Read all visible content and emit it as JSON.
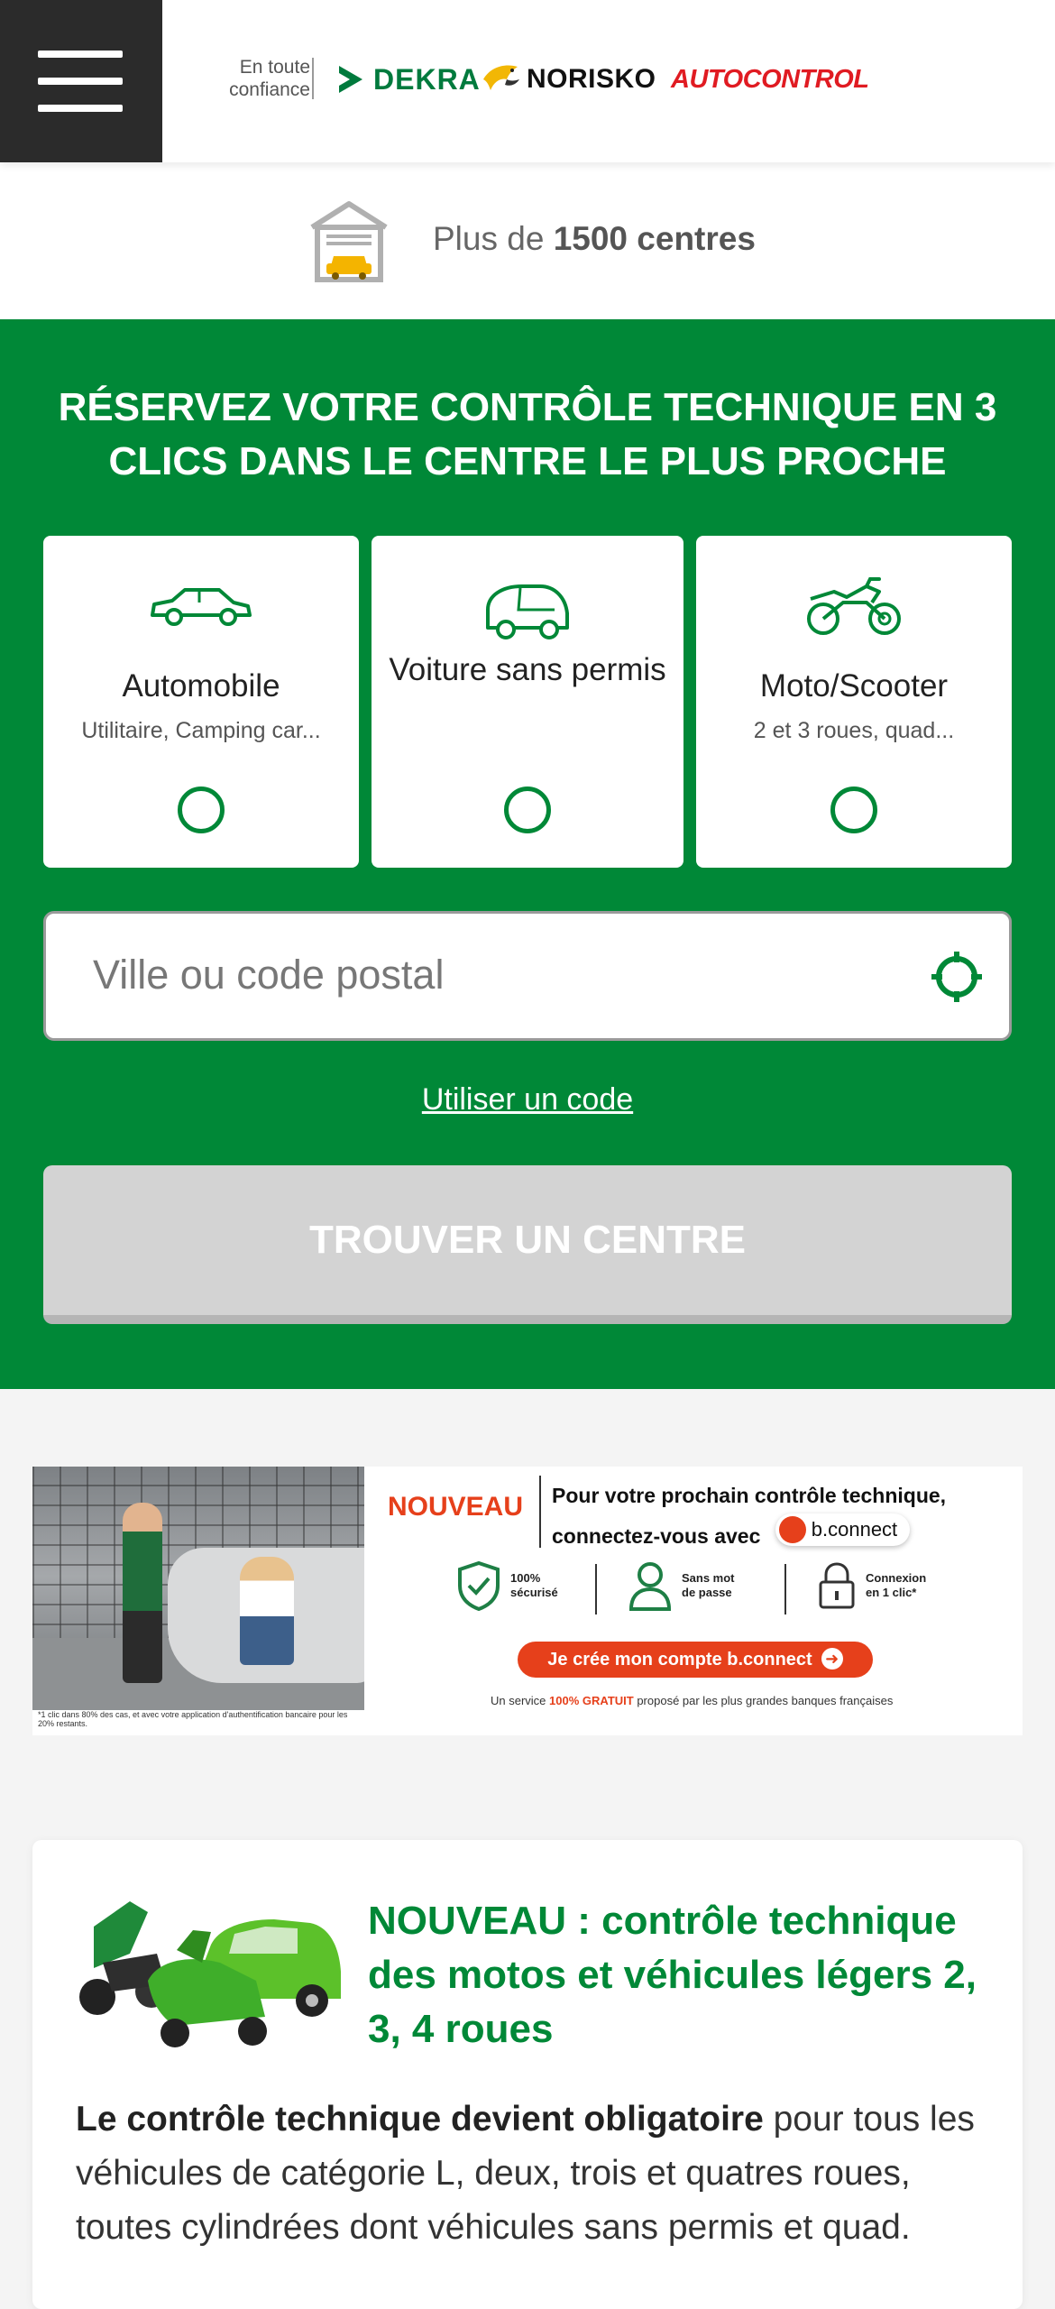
{
  "header": {
    "menu_icon": "hamburger-menu-icon",
    "tagline": "En toute confiance",
    "brands": [
      "DEKRA",
      "NORISKO",
      "AUTOCONTROL"
    ],
    "brand_colors": {
      "dekra": "#007a3d",
      "norisko": "#111111",
      "autocontrol": "#e01b22"
    }
  },
  "centres": {
    "prefix": "Plus de ",
    "highlight": "1500 centres",
    "icon": "garage-car-icon"
  },
  "booking": {
    "title": "RÉSERVEZ VOTRE CONTRÔLE TECHNIQUE EN 3 CLICS DANS LE CENTRE LE PLUS PROCHE",
    "vehicles": [
      {
        "title": "Automobile",
        "subtitle": "Utilitaire, Camping car...",
        "icon": "car-icon"
      },
      {
        "title": "Voiture sans permis",
        "subtitle": "",
        "icon": "microcar-icon"
      },
      {
        "title": "Moto/Scooter",
        "subtitle": "2 et 3 roues, quad...",
        "icon": "motorcycle-icon"
      }
    ],
    "search_placeholder": "Ville ou code postal",
    "locate_icon": "locate-target-icon",
    "use_code": "Utiliser un code",
    "find_button": "TROUVER UN CENTRE",
    "colors": {
      "background": "#008837",
      "button_disabled": "#d3d3d3"
    }
  },
  "banner": {
    "nouveau": "NOUVEAU",
    "headline_1": "Pour votre prochain contrôle technique,",
    "headline_2": "connectez-vous avec",
    "bconnect": "b.connect",
    "features": [
      {
        "label_1": "100%",
        "label_2": "sécurisé",
        "icon": "shield-check-icon"
      },
      {
        "label_1": "Sans mot",
        "label_2": "de passe",
        "icon": "user-icon"
      },
      {
        "label_1": "Connexion",
        "label_2": "en 1 clic*",
        "icon": "padlock-icon"
      }
    ],
    "cta": "Je crée mon compte b.connect",
    "note_prefix": "Un service ",
    "note_highlight": "100% GRATUIT",
    "note_suffix": " proposé par les plus grandes banques françaises",
    "footnote": "*1 clic dans 80% des cas, et avec votre application d'authentification bancaire pour les 20% restants.",
    "accent": "#e6401b"
  },
  "news": {
    "title": "NOUVEAU : contrôle technique des motos et véhicules légers 2, 3, 4 roues",
    "body_bold": "Le contrôle technique devient obligatoire",
    "body_rest": " pour tous les véhicules de catégorie L, deux, trois et quatres roues, toutes cylindrées dont véhicules sans permis et quad."
  }
}
